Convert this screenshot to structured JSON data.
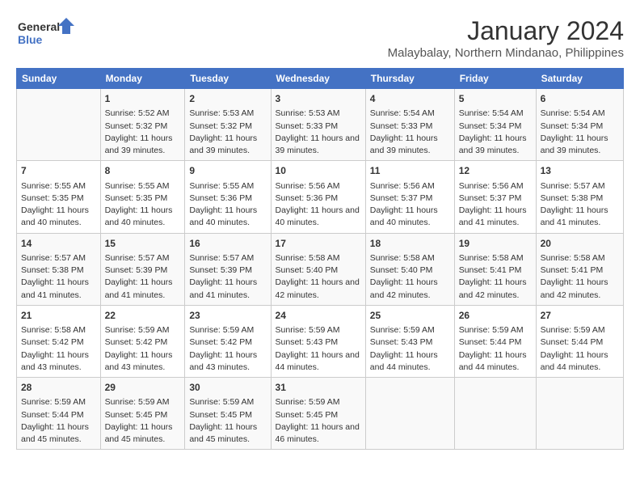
{
  "header": {
    "logo_line1": "General",
    "logo_line2": "Blue",
    "main_title": "January 2024",
    "subtitle": "Malaybalay, Northern Mindanao, Philippines"
  },
  "days_of_week": [
    "Sunday",
    "Monday",
    "Tuesday",
    "Wednesday",
    "Thursday",
    "Friday",
    "Saturday"
  ],
  "weeks": [
    [
      {
        "day": "",
        "sunrise": "",
        "sunset": "",
        "daylight": ""
      },
      {
        "day": "1",
        "sunrise": "Sunrise: 5:52 AM",
        "sunset": "Sunset: 5:32 PM",
        "daylight": "Daylight: 11 hours and 39 minutes."
      },
      {
        "day": "2",
        "sunrise": "Sunrise: 5:53 AM",
        "sunset": "Sunset: 5:32 PM",
        "daylight": "Daylight: 11 hours and 39 minutes."
      },
      {
        "day": "3",
        "sunrise": "Sunrise: 5:53 AM",
        "sunset": "Sunset: 5:33 PM",
        "daylight": "Daylight: 11 hours and 39 minutes."
      },
      {
        "day": "4",
        "sunrise": "Sunrise: 5:54 AM",
        "sunset": "Sunset: 5:33 PM",
        "daylight": "Daylight: 11 hours and 39 minutes."
      },
      {
        "day": "5",
        "sunrise": "Sunrise: 5:54 AM",
        "sunset": "Sunset: 5:34 PM",
        "daylight": "Daylight: 11 hours and 39 minutes."
      },
      {
        "day": "6",
        "sunrise": "Sunrise: 5:54 AM",
        "sunset": "Sunset: 5:34 PM",
        "daylight": "Daylight: 11 hours and 39 minutes."
      }
    ],
    [
      {
        "day": "7",
        "sunrise": "Sunrise: 5:55 AM",
        "sunset": "Sunset: 5:35 PM",
        "daylight": "Daylight: 11 hours and 40 minutes."
      },
      {
        "day": "8",
        "sunrise": "Sunrise: 5:55 AM",
        "sunset": "Sunset: 5:35 PM",
        "daylight": "Daylight: 11 hours and 40 minutes."
      },
      {
        "day": "9",
        "sunrise": "Sunrise: 5:55 AM",
        "sunset": "Sunset: 5:36 PM",
        "daylight": "Daylight: 11 hours and 40 minutes."
      },
      {
        "day": "10",
        "sunrise": "Sunrise: 5:56 AM",
        "sunset": "Sunset: 5:36 PM",
        "daylight": "Daylight: 11 hours and 40 minutes."
      },
      {
        "day": "11",
        "sunrise": "Sunrise: 5:56 AM",
        "sunset": "Sunset: 5:37 PM",
        "daylight": "Daylight: 11 hours and 40 minutes."
      },
      {
        "day": "12",
        "sunrise": "Sunrise: 5:56 AM",
        "sunset": "Sunset: 5:37 PM",
        "daylight": "Daylight: 11 hours and 41 minutes."
      },
      {
        "day": "13",
        "sunrise": "Sunrise: 5:57 AM",
        "sunset": "Sunset: 5:38 PM",
        "daylight": "Daylight: 11 hours and 41 minutes."
      }
    ],
    [
      {
        "day": "14",
        "sunrise": "Sunrise: 5:57 AM",
        "sunset": "Sunset: 5:38 PM",
        "daylight": "Daylight: 11 hours and 41 minutes."
      },
      {
        "day": "15",
        "sunrise": "Sunrise: 5:57 AM",
        "sunset": "Sunset: 5:39 PM",
        "daylight": "Daylight: 11 hours and 41 minutes."
      },
      {
        "day": "16",
        "sunrise": "Sunrise: 5:57 AM",
        "sunset": "Sunset: 5:39 PM",
        "daylight": "Daylight: 11 hours and 41 minutes."
      },
      {
        "day": "17",
        "sunrise": "Sunrise: 5:58 AM",
        "sunset": "Sunset: 5:40 PM",
        "daylight": "Daylight: 11 hours and 42 minutes."
      },
      {
        "day": "18",
        "sunrise": "Sunrise: 5:58 AM",
        "sunset": "Sunset: 5:40 PM",
        "daylight": "Daylight: 11 hours and 42 minutes."
      },
      {
        "day": "19",
        "sunrise": "Sunrise: 5:58 AM",
        "sunset": "Sunset: 5:41 PM",
        "daylight": "Daylight: 11 hours and 42 minutes."
      },
      {
        "day": "20",
        "sunrise": "Sunrise: 5:58 AM",
        "sunset": "Sunset: 5:41 PM",
        "daylight": "Daylight: 11 hours and 42 minutes."
      }
    ],
    [
      {
        "day": "21",
        "sunrise": "Sunrise: 5:58 AM",
        "sunset": "Sunset: 5:42 PM",
        "daylight": "Daylight: 11 hours and 43 minutes."
      },
      {
        "day": "22",
        "sunrise": "Sunrise: 5:59 AM",
        "sunset": "Sunset: 5:42 PM",
        "daylight": "Daylight: 11 hours and 43 minutes."
      },
      {
        "day": "23",
        "sunrise": "Sunrise: 5:59 AM",
        "sunset": "Sunset: 5:42 PM",
        "daylight": "Daylight: 11 hours and 43 minutes."
      },
      {
        "day": "24",
        "sunrise": "Sunrise: 5:59 AM",
        "sunset": "Sunset: 5:43 PM",
        "daylight": "Daylight: 11 hours and 44 minutes."
      },
      {
        "day": "25",
        "sunrise": "Sunrise: 5:59 AM",
        "sunset": "Sunset: 5:43 PM",
        "daylight": "Daylight: 11 hours and 44 minutes."
      },
      {
        "day": "26",
        "sunrise": "Sunrise: 5:59 AM",
        "sunset": "Sunset: 5:44 PM",
        "daylight": "Daylight: 11 hours and 44 minutes."
      },
      {
        "day": "27",
        "sunrise": "Sunrise: 5:59 AM",
        "sunset": "Sunset: 5:44 PM",
        "daylight": "Daylight: 11 hours and 44 minutes."
      }
    ],
    [
      {
        "day": "28",
        "sunrise": "Sunrise: 5:59 AM",
        "sunset": "Sunset: 5:44 PM",
        "daylight": "Daylight: 11 hours and 45 minutes."
      },
      {
        "day": "29",
        "sunrise": "Sunrise: 5:59 AM",
        "sunset": "Sunset: 5:45 PM",
        "daylight": "Daylight: 11 hours and 45 minutes."
      },
      {
        "day": "30",
        "sunrise": "Sunrise: 5:59 AM",
        "sunset": "Sunset: 5:45 PM",
        "daylight": "Daylight: 11 hours and 45 minutes."
      },
      {
        "day": "31",
        "sunrise": "Sunrise: 5:59 AM",
        "sunset": "Sunset: 5:45 PM",
        "daylight": "Daylight: 11 hours and 46 minutes."
      },
      {
        "day": "",
        "sunrise": "",
        "sunset": "",
        "daylight": ""
      },
      {
        "day": "",
        "sunrise": "",
        "sunset": "",
        "daylight": ""
      },
      {
        "day": "",
        "sunrise": "",
        "sunset": "",
        "daylight": ""
      }
    ]
  ]
}
